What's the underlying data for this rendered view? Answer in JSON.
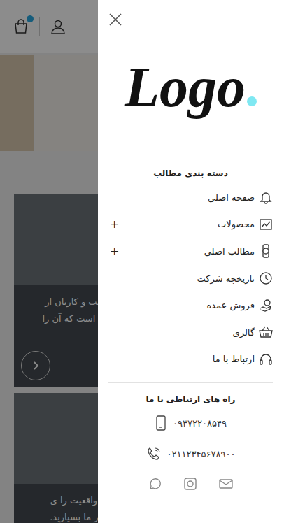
{
  "page": {
    "cards": [
      {
        "lines": [
          "سب و کارتان از",
          "ن است که آن را"
        ],
        "has_arrow": true
      },
      {
        "lines": [
          "ه واقعیت را ی",
          "دار ما بسپارید."
        ],
        "has_arrow": false
      }
    ]
  },
  "drawer": {
    "logo": "Logo",
    "categories_title": "دسته بندی مطالب",
    "menu": [
      {
        "label": "صفحه اصلی",
        "expander": ""
      },
      {
        "label": "محصولات",
        "expander": "+"
      },
      {
        "label": "مطالب اصلی",
        "expander": "+"
      },
      {
        "label": "تاریخچه شرکت",
        "expander": ""
      },
      {
        "label": "فروش عمده",
        "expander": ""
      },
      {
        "label": "گالری",
        "expander": ""
      },
      {
        "label": "ارتباط با ما",
        "expander": ""
      }
    ],
    "contact_title": "راه های ارتباطی با ما",
    "phones": [
      {
        "number": "۰۹۳۷۲۲۰۸۵۴۹",
        "kind": "mobile"
      },
      {
        "number": "۰۲۱۱۲۳۴۵۶۷۸۹۰۰",
        "kind": "landline"
      }
    ]
  }
}
